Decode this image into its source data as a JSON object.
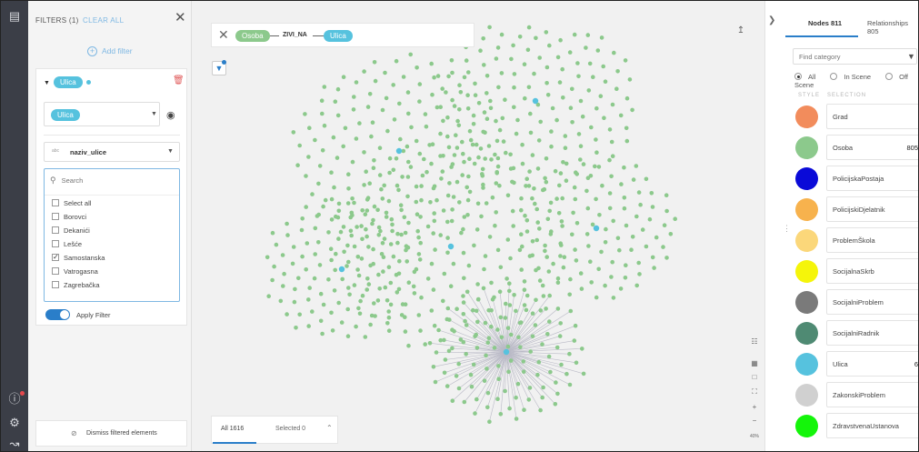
{
  "filters": {
    "header_title": "FILTERS (1)",
    "clear_all": "CLEAR ALL",
    "add_filter": "Add filter",
    "category_pill": "Ulica",
    "select_category": "Ulica",
    "property": "naziv_ulice",
    "property_type": "abc",
    "search_placeholder": "Search",
    "values": [
      {
        "label": "Select all",
        "checked": false
      },
      {
        "label": "Borovci",
        "checked": false
      },
      {
        "label": "Dekanići",
        "checked": false
      },
      {
        "label": "Lešće",
        "checked": false
      },
      {
        "label": "Samostanska",
        "checked": true
      },
      {
        "label": "Vatrogasna",
        "checked": false
      },
      {
        "label": "Zagrebačka",
        "checked": false
      }
    ],
    "apply_filter": "Apply Filter",
    "dismiss": "Dismiss filtered elements"
  },
  "query": {
    "from_node": "Osoba",
    "relationship": "ZIVI_NA",
    "to_node": "Ulica"
  },
  "bottom_bar": {
    "all": "All 1616",
    "selected": "Selected 0"
  },
  "right_panel": {
    "tab_nodes": "Nodes 811",
    "tab_relationships": "Relationships 805",
    "find_placeholder": "Find category",
    "radio_all": "All",
    "radio_in_scene": "In Scene",
    "radio_off_scene": "Off Scene",
    "col_style": "STYLE",
    "col_selection": "SELECTION",
    "categories": [
      {
        "name": "Grad",
        "color": "#f28c5c",
        "count": ""
      },
      {
        "name": "Osoba",
        "color": "#8cc98c",
        "count": "805"
      },
      {
        "name": "PolicijskaPostaja",
        "color": "#0a0ad8",
        "count": ""
      },
      {
        "name": "PolicijskiDjelatnik",
        "color": "#f7b24d",
        "count": ""
      },
      {
        "name": "ProblemŠkola",
        "color": "#fbd77a",
        "count": ""
      },
      {
        "name": "SocijalnaSkrb",
        "color": "#f5f50a",
        "count": ""
      },
      {
        "name": "SocijalniProblem",
        "color": "#7a7a7a",
        "count": ""
      },
      {
        "name": "SocijalniRadnik",
        "color": "#4f8a73",
        "count": ""
      },
      {
        "name": "Ulica",
        "color": "#56c2de",
        "count": "6"
      },
      {
        "name": "ZakonskiProblem",
        "color": "#d0d0d0",
        "count": ""
      },
      {
        "name": "ZdravstvenaUstanova",
        "color": "#14f50a",
        "count": ""
      }
    ]
  },
  "colors": {
    "accent": "#2a7ec9",
    "osoba_node": "#8cc98c",
    "ulica_node": "#56c2de"
  },
  "zoom_label": "40%",
  "graph": {
    "osoba_nodes": 805,
    "ulica_nodes": 6
  }
}
